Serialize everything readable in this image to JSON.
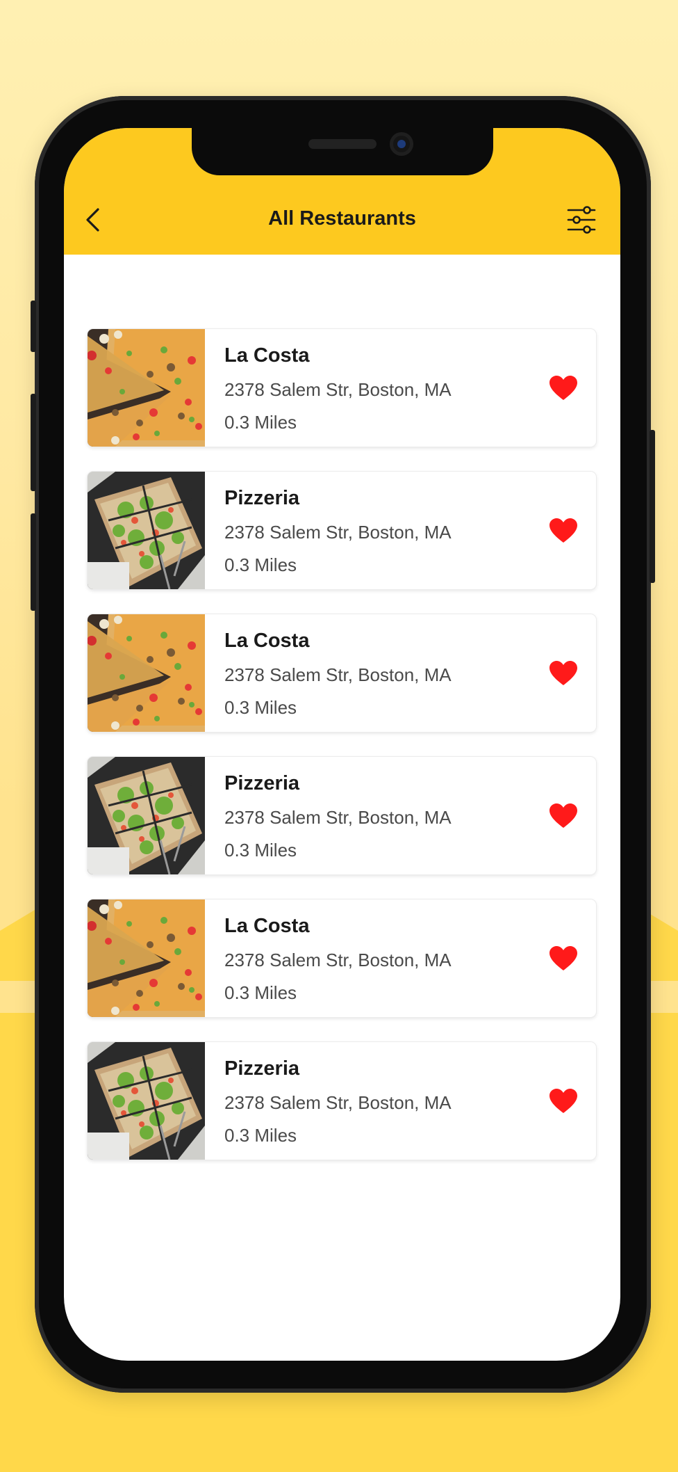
{
  "header": {
    "title": "All Restaurants",
    "back_icon": "chevron-left-icon",
    "filter_icon": "sliders-icon"
  },
  "colors": {
    "accent": "#fdc91f",
    "favorite": "#ff1a1a"
  },
  "restaurants": [
    {
      "name": "La Costa",
      "address": "2378 Salem Str, Boston, MA",
      "distance": "0.3 Miles",
      "image": "pizza-pepperoni",
      "favorite": true
    },
    {
      "name": "Pizzeria",
      "address": "2378 Salem Str, Boston, MA",
      "distance": "0.3 Miles",
      "image": "pizza-greens",
      "favorite": true
    },
    {
      "name": "La Costa",
      "address": "2378 Salem Str, Boston, MA",
      "distance": "0.3 Miles",
      "image": "pizza-pepperoni",
      "favorite": true
    },
    {
      "name": "Pizzeria",
      "address": "2378 Salem Str, Boston, MA",
      "distance": "0.3 Miles",
      "image": "pizza-greens",
      "favorite": true
    },
    {
      "name": "La Costa",
      "address": "2378 Salem Str, Boston, MA",
      "distance": "0.3 Miles",
      "image": "pizza-pepperoni",
      "favorite": true
    },
    {
      "name": "Pizzeria",
      "address": "2378 Salem Str, Boston, MA",
      "distance": "0.3 Miles",
      "image": "pizza-greens",
      "favorite": true
    }
  ]
}
